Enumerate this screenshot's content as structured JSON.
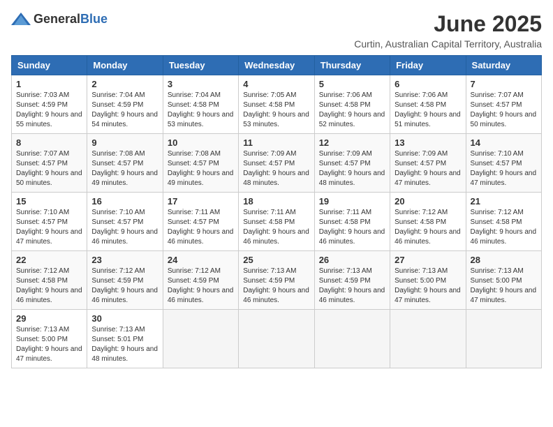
{
  "header": {
    "logo_general": "General",
    "logo_blue": "Blue",
    "month_title": "June 2025",
    "location": "Curtin, Australian Capital Territory, Australia"
  },
  "weekdays": [
    "Sunday",
    "Monday",
    "Tuesday",
    "Wednesday",
    "Thursday",
    "Friday",
    "Saturday"
  ],
  "weeks": [
    [
      {
        "day": "1",
        "sunrise": "7:03 AM",
        "sunset": "4:59 PM",
        "daylight": "9 hours and 55 minutes."
      },
      {
        "day": "2",
        "sunrise": "7:04 AM",
        "sunset": "4:59 PM",
        "daylight": "9 hours and 54 minutes."
      },
      {
        "day": "3",
        "sunrise": "7:04 AM",
        "sunset": "4:58 PM",
        "daylight": "9 hours and 53 minutes."
      },
      {
        "day": "4",
        "sunrise": "7:05 AM",
        "sunset": "4:58 PM",
        "daylight": "9 hours and 53 minutes."
      },
      {
        "day": "5",
        "sunrise": "7:06 AM",
        "sunset": "4:58 PM",
        "daylight": "9 hours and 52 minutes."
      },
      {
        "day": "6",
        "sunrise": "7:06 AM",
        "sunset": "4:58 PM",
        "daylight": "9 hours and 51 minutes."
      },
      {
        "day": "7",
        "sunrise": "7:07 AM",
        "sunset": "4:57 PM",
        "daylight": "9 hours and 50 minutes."
      }
    ],
    [
      {
        "day": "8",
        "sunrise": "7:07 AM",
        "sunset": "4:57 PM",
        "daylight": "9 hours and 50 minutes."
      },
      {
        "day": "9",
        "sunrise": "7:08 AM",
        "sunset": "4:57 PM",
        "daylight": "9 hours and 49 minutes."
      },
      {
        "day": "10",
        "sunrise": "7:08 AM",
        "sunset": "4:57 PM",
        "daylight": "9 hours and 49 minutes."
      },
      {
        "day": "11",
        "sunrise": "7:09 AM",
        "sunset": "4:57 PM",
        "daylight": "9 hours and 48 minutes."
      },
      {
        "day": "12",
        "sunrise": "7:09 AM",
        "sunset": "4:57 PM",
        "daylight": "9 hours and 48 minutes."
      },
      {
        "day": "13",
        "sunrise": "7:09 AM",
        "sunset": "4:57 PM",
        "daylight": "9 hours and 47 minutes."
      },
      {
        "day": "14",
        "sunrise": "7:10 AM",
        "sunset": "4:57 PM",
        "daylight": "9 hours and 47 minutes."
      }
    ],
    [
      {
        "day": "15",
        "sunrise": "7:10 AM",
        "sunset": "4:57 PM",
        "daylight": "9 hours and 47 minutes."
      },
      {
        "day": "16",
        "sunrise": "7:10 AM",
        "sunset": "4:57 PM",
        "daylight": "9 hours and 46 minutes."
      },
      {
        "day": "17",
        "sunrise": "7:11 AM",
        "sunset": "4:57 PM",
        "daylight": "9 hours and 46 minutes."
      },
      {
        "day": "18",
        "sunrise": "7:11 AM",
        "sunset": "4:58 PM",
        "daylight": "9 hours and 46 minutes."
      },
      {
        "day": "19",
        "sunrise": "7:11 AM",
        "sunset": "4:58 PM",
        "daylight": "9 hours and 46 minutes."
      },
      {
        "day": "20",
        "sunrise": "7:12 AM",
        "sunset": "4:58 PM",
        "daylight": "9 hours and 46 minutes."
      },
      {
        "day": "21",
        "sunrise": "7:12 AM",
        "sunset": "4:58 PM",
        "daylight": "9 hours and 46 minutes."
      }
    ],
    [
      {
        "day": "22",
        "sunrise": "7:12 AM",
        "sunset": "4:58 PM",
        "daylight": "9 hours and 46 minutes."
      },
      {
        "day": "23",
        "sunrise": "7:12 AM",
        "sunset": "4:59 PM",
        "daylight": "9 hours and 46 minutes."
      },
      {
        "day": "24",
        "sunrise": "7:12 AM",
        "sunset": "4:59 PM",
        "daylight": "9 hours and 46 minutes."
      },
      {
        "day": "25",
        "sunrise": "7:13 AM",
        "sunset": "4:59 PM",
        "daylight": "9 hours and 46 minutes."
      },
      {
        "day": "26",
        "sunrise": "7:13 AM",
        "sunset": "4:59 PM",
        "daylight": "9 hours and 46 minutes."
      },
      {
        "day": "27",
        "sunrise": "7:13 AM",
        "sunset": "5:00 PM",
        "daylight": "9 hours and 47 minutes."
      },
      {
        "day": "28",
        "sunrise": "7:13 AM",
        "sunset": "5:00 PM",
        "daylight": "9 hours and 47 minutes."
      }
    ],
    [
      {
        "day": "29",
        "sunrise": "7:13 AM",
        "sunset": "5:00 PM",
        "daylight": "9 hours and 47 minutes."
      },
      {
        "day": "30",
        "sunrise": "7:13 AM",
        "sunset": "5:01 PM",
        "daylight": "9 hours and 48 minutes."
      },
      null,
      null,
      null,
      null,
      null
    ]
  ]
}
